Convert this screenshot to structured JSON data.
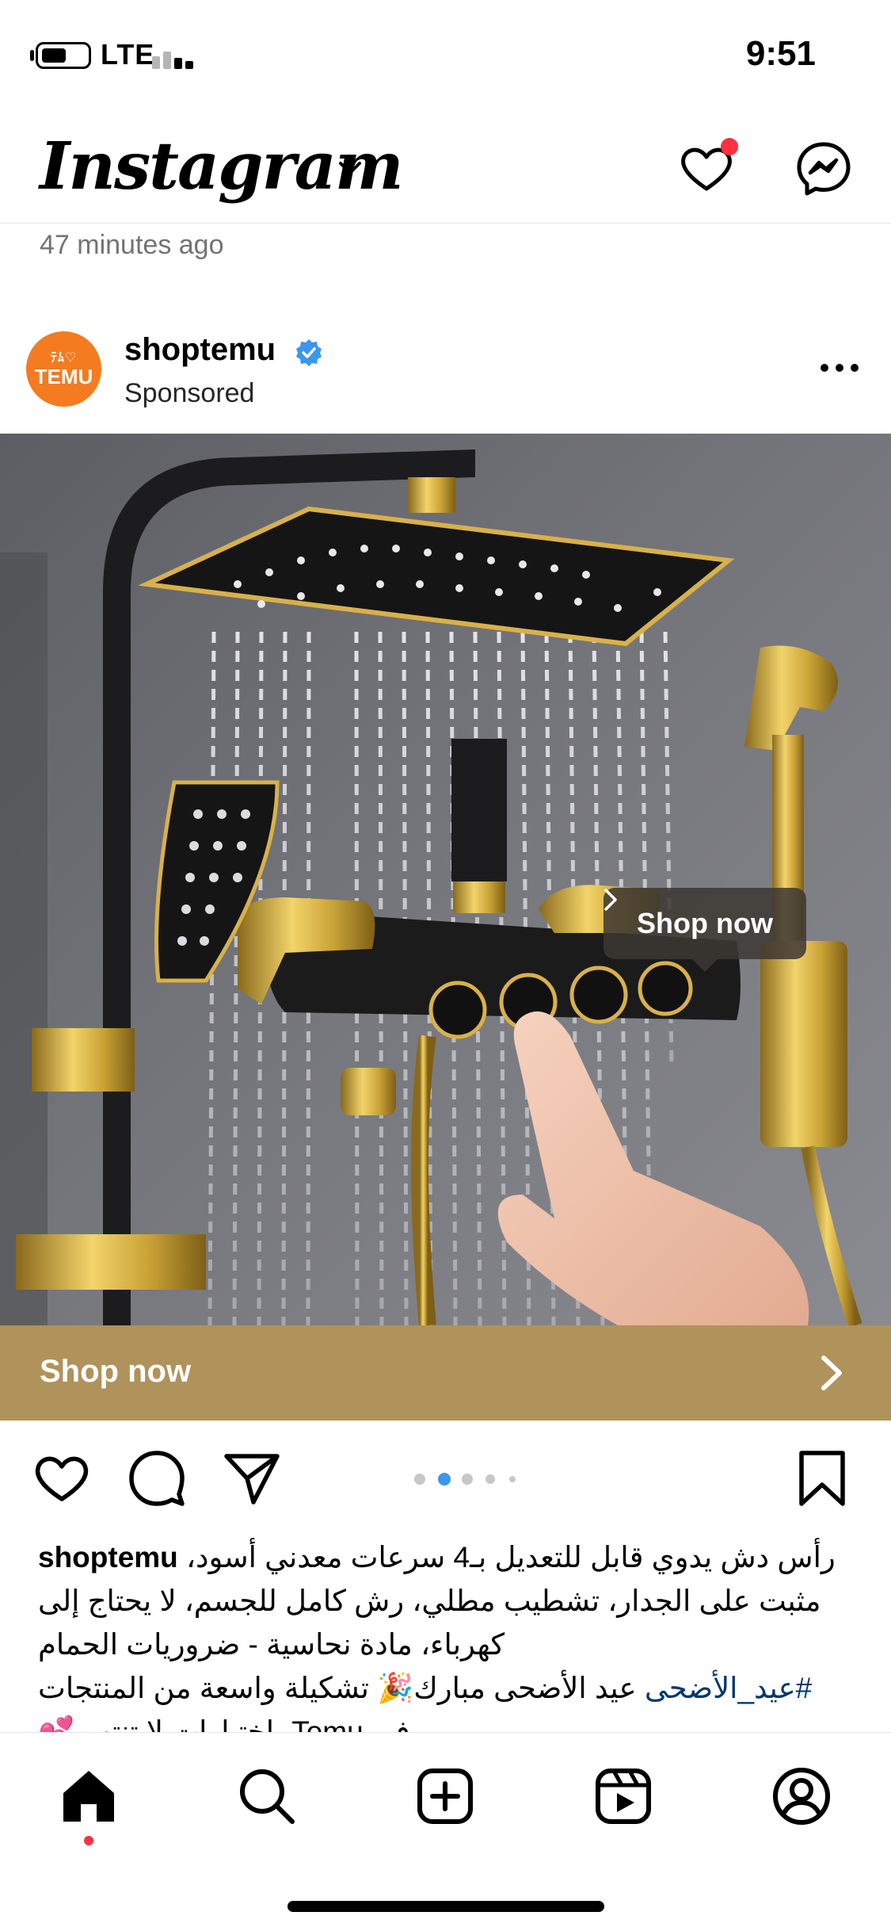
{
  "status_bar": {
    "network": "LTE",
    "time": "9:51",
    "battery_level": 0.55
  },
  "header": {
    "app_name": "Instagram",
    "icons": [
      "chevron-down-icon",
      "heart-icon",
      "messenger-icon"
    ],
    "has_notification": true
  },
  "previous_post": {
    "timestamp": "47 minutes ago"
  },
  "post": {
    "avatar_text_top": "ﾃﾑ♡",
    "avatar_text": "TEMU",
    "username": "shoptemu",
    "verified": true,
    "sponsored_label": "Sponsored",
    "media_description_icon": "shower-system-image",
    "shop_tag_label": "Shop now",
    "cta_label": "Shop now",
    "carousel": {
      "total": 5,
      "active_index": 1
    },
    "caption": {
      "username": "shoptemu",
      "text_line1": "رأس دش يدوي قابل للتعديل بـ4 سرعات معدني أسود، مثبت على الجدار، تشطيب مطلي، رش كامل للجسم، لا يحتاج إلى كهرباء، مادة نحاسية - ضروريات الحمام",
      "hashtag": "#عيد_الأضحى",
      "text_line2": "عيد الأضحى مبارك🎉 تشكيلة واسعة من المنتجات في Temu، اختيارات لا تنتهي💕"
    }
  },
  "bottom_nav": {
    "items": [
      "home-icon",
      "search-icon",
      "create-icon",
      "reels-icon",
      "profile-icon"
    ],
    "active": "home-icon"
  },
  "colors": {
    "cta_background": "#b0925b",
    "notification": "#ff3040",
    "verified": "#3897f0",
    "avatar": "#f47b20",
    "carousel_active": "#3897f0"
  }
}
